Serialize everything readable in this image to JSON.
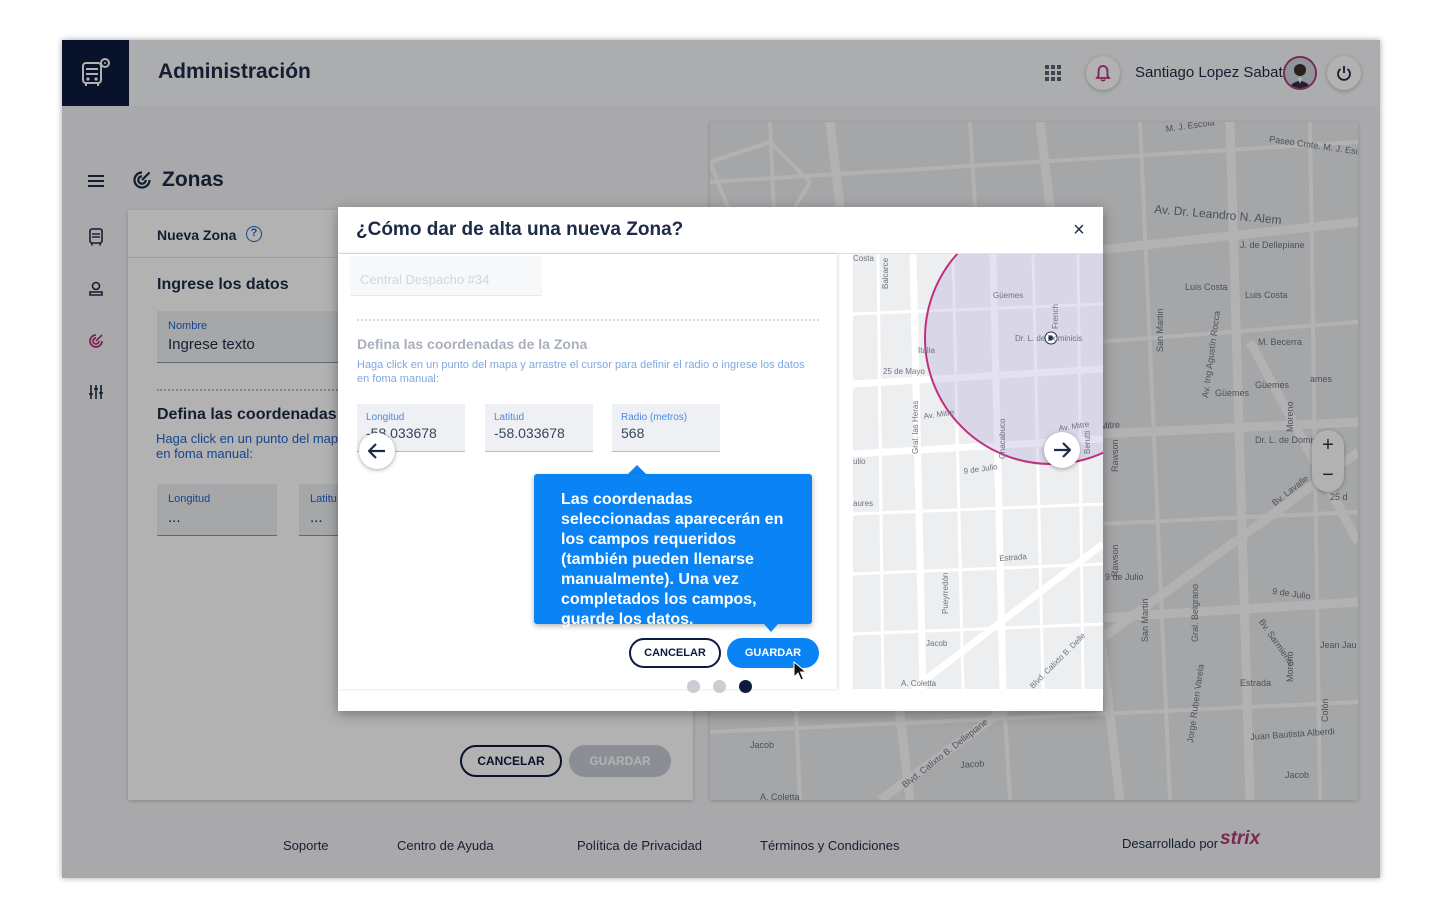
{
  "header": {
    "app_title": "Administración",
    "user_name": "Santiago Lopez Sabat"
  },
  "page": {
    "title": "Zonas"
  },
  "form": {
    "header_title": "Nueva Zona",
    "help_symbol": "?",
    "section_title": "Ingrese los datos",
    "nombre_label": "Nombre",
    "nombre_value": "Ingrese texto",
    "coords_title": "Defina las coordenadas de",
    "coords_help": "Haga click en un punto del mapa en foma manual:",
    "lon_label": "Longitud",
    "lon_value": "...",
    "lat_label": "Latitu",
    "lat_value": "...",
    "cancel_label": "CANCELAR",
    "save_label": "GUARDAR"
  },
  "map": {
    "zoom_in": "+",
    "zoom_out": "−",
    "street_labels": [
      "M. J. Escola",
      "Paseo Cmte. M. J. Esc",
      "Av. Dr. Leandro N. Alem",
      "J. de Dellepiane",
      "Luis Costa",
      "Luis Costa",
      "Av. Ing Agustín Rocca",
      "M. Becerra",
      "Güemes",
      "Güemes",
      "Dr. L. de Dominicis",
      "Av. Mitre",
      "Bv. Lavalle",
      "9 de Julio",
      "9 de Julio",
      "Bv. Sarmiento",
      "Estrada",
      "Juan Bautista Alberdi",
      "Jorge Ruben Varela",
      "Jacob",
      "Jacob",
      "Jacob",
      "Blvd. Calixto B. Dellepiane",
      "A. Coletta",
      "Rawson",
      "Rawson",
      "San Martin",
      "San Martin",
      "Gral. Belgrano",
      "Moreno",
      "Moreno",
      "Colón",
      "Jean Jau",
      "25 d",
      "ames"
    ]
  },
  "footer": {
    "links": [
      "Soporte",
      "Centro de Ayuda",
      "Política de Privacidad",
      "Términos y Condiciones"
    ],
    "dev_by": "Desarrollado por",
    "brand": "strix"
  },
  "modal": {
    "title": "¿Cómo dar de alta una nueva Zona?",
    "close": "×",
    "ghost_input": "Central Despacho #34",
    "coords_title": "Defina las coordenadas de la Zona",
    "coords_help": "Haga click en un punto del mapa y arrastre el cursor para definir el radio o ingrese los datos en foma manual:",
    "lon_label": "Longitud",
    "lon_value": "-58.033678",
    "lat_label": "Latitud",
    "lat_value": "-58.033678",
    "radius_label": "Radio (metros)",
    "radius_value": "568",
    "tooltip": "Las coordenadas seleccionadas aparecerán en los campos requeridos (también pueden llenarse manualmente). Una vez completados los campos, guarde los datos.",
    "cancel_label": "CANCELAR",
    "save_label": "GUARDAR",
    "map_labels": [
      "Costa",
      "Balcarce",
      "Güemes",
      "Dr. L. de Dominicis",
      "French",
      "Italia",
      "25 de Mayo",
      "Av. Mitre",
      "Av. Mitre",
      "9 de Julio",
      "Estrada",
      "Jacob",
      "Blvd. Calixto B. Delle",
      "A. Coletta",
      "Gral. las Heras",
      "Pueyrredón",
      "Chacabuco",
      "Berutti",
      "ulio",
      "aures"
    ],
    "pager_count": 3,
    "pager_active": 3
  }
}
